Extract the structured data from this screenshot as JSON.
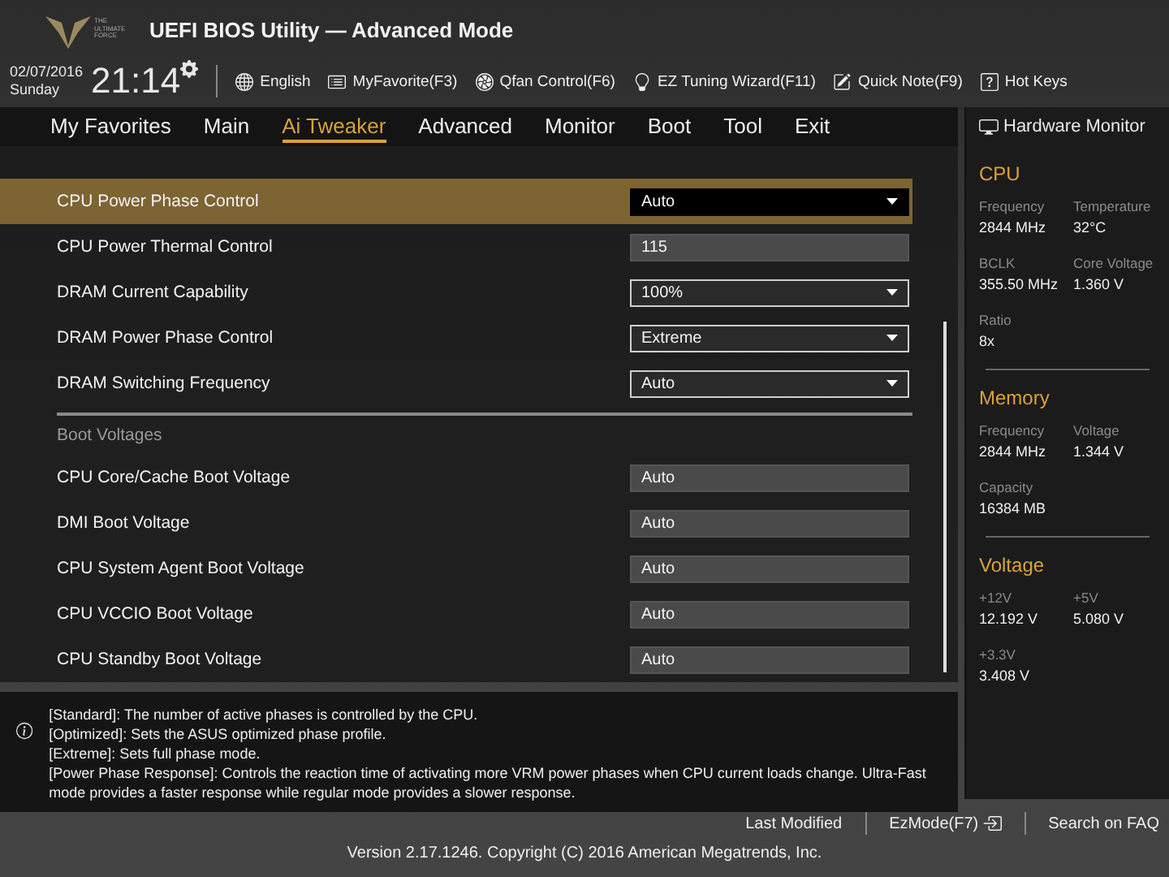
{
  "logo_text": "THE ULTIMATE FORCE",
  "window": {
    "title": "UEFI BIOS Utility — Advanced Mode"
  },
  "clock": {
    "date": "02/07/2016",
    "day": "Sunday",
    "time": "21:14"
  },
  "toolbar": [
    {
      "label": "English"
    },
    {
      "label": "MyFavorite(F3)"
    },
    {
      "label": "Qfan Control(F6)"
    },
    {
      "label": "EZ Tuning Wizard(F11)"
    },
    {
      "label": "Quick Note(F9)"
    },
    {
      "label": "Hot Keys"
    }
  ],
  "tabs": [
    {
      "label": "My Favorites",
      "selected": false
    },
    {
      "label": "Main",
      "selected": false
    },
    {
      "label": "Ai Tweaker",
      "selected": true
    },
    {
      "label": "Advanced",
      "selected": false
    },
    {
      "label": "Monitor",
      "selected": false
    },
    {
      "label": "Boot",
      "selected": false
    },
    {
      "label": "Tool",
      "selected": false
    },
    {
      "label": "Exit",
      "selected": false
    }
  ],
  "settings": [
    {
      "kind": "select",
      "label": "CPU Power Phase Control",
      "value": "Auto",
      "selected": true
    },
    {
      "kind": "value",
      "label": "CPU Power Thermal Control",
      "value": "115",
      "selected": false
    },
    {
      "kind": "select",
      "label": "DRAM Current Capability",
      "value": "100%",
      "selected": false
    },
    {
      "kind": "select",
      "label": "DRAM Power Phase Control",
      "value": "Extreme",
      "selected": false
    },
    {
      "kind": "select",
      "label": "DRAM Switching Frequency",
      "value": "Auto",
      "selected": false
    },
    {
      "kind": "divider"
    },
    {
      "kind": "heading",
      "label": "Boot Voltages"
    },
    {
      "kind": "value",
      "label": "CPU Core/Cache Boot Voltage",
      "value": "Auto",
      "selected": false
    },
    {
      "kind": "value",
      "label": "DMI Boot Voltage",
      "value": "Auto",
      "selected": false
    },
    {
      "kind": "value",
      "label": "CPU System Agent Boot Voltage",
      "value": "Auto",
      "selected": false
    },
    {
      "kind": "value",
      "label": "CPU VCCIO Boot Voltage",
      "value": "Auto",
      "selected": false
    },
    {
      "kind": "value",
      "label": "CPU Standby Boot Voltage",
      "value": "Auto",
      "selected": false
    }
  ],
  "help": [
    "[Standard]: The number of active phases is controlled by the CPU.",
    "[Optimized]: Sets the ASUS optimized phase profile.",
    "[Extreme]: Sets full phase mode.",
    "[Power Phase Response]: Controls the reaction time of activating more VRM power phases when CPU current loads change. Ultra-Fast mode provides a faster response while regular mode provides a slower response."
  ],
  "hardware_monitor": {
    "title": "Hardware Monitor",
    "sections": [
      {
        "title": "CPU",
        "items": [
          {
            "label": "Frequency",
            "value": "2844 MHz"
          },
          {
            "label": "Temperature",
            "value": "32°C"
          },
          {
            "label": "BCLK",
            "value": "355.50 MHz"
          },
          {
            "label": "Core Voltage",
            "value": "1.360 V"
          },
          {
            "label": "Ratio",
            "value": "8x"
          }
        ]
      },
      {
        "title": "Memory",
        "items": [
          {
            "label": "Frequency",
            "value": "2844 MHz"
          },
          {
            "label": "Voltage",
            "value": "1.344 V"
          },
          {
            "label": "Capacity",
            "value": "16384 MB"
          }
        ]
      },
      {
        "title": "Voltage",
        "items": [
          {
            "label": "+12V",
            "value": "12.192 V"
          },
          {
            "label": "+5V",
            "value": "5.080 V"
          },
          {
            "label": "+3.3V",
            "value": "3.408 V"
          }
        ]
      }
    ]
  },
  "footer": {
    "links": [
      {
        "label": "Last Modified"
      },
      {
        "label": "EzMode(F7)"
      },
      {
        "label": "Search on FAQ"
      }
    ],
    "version": "Version 2.17.1246. Copyright (C) 2016 American Megatrends, Inc."
  }
}
